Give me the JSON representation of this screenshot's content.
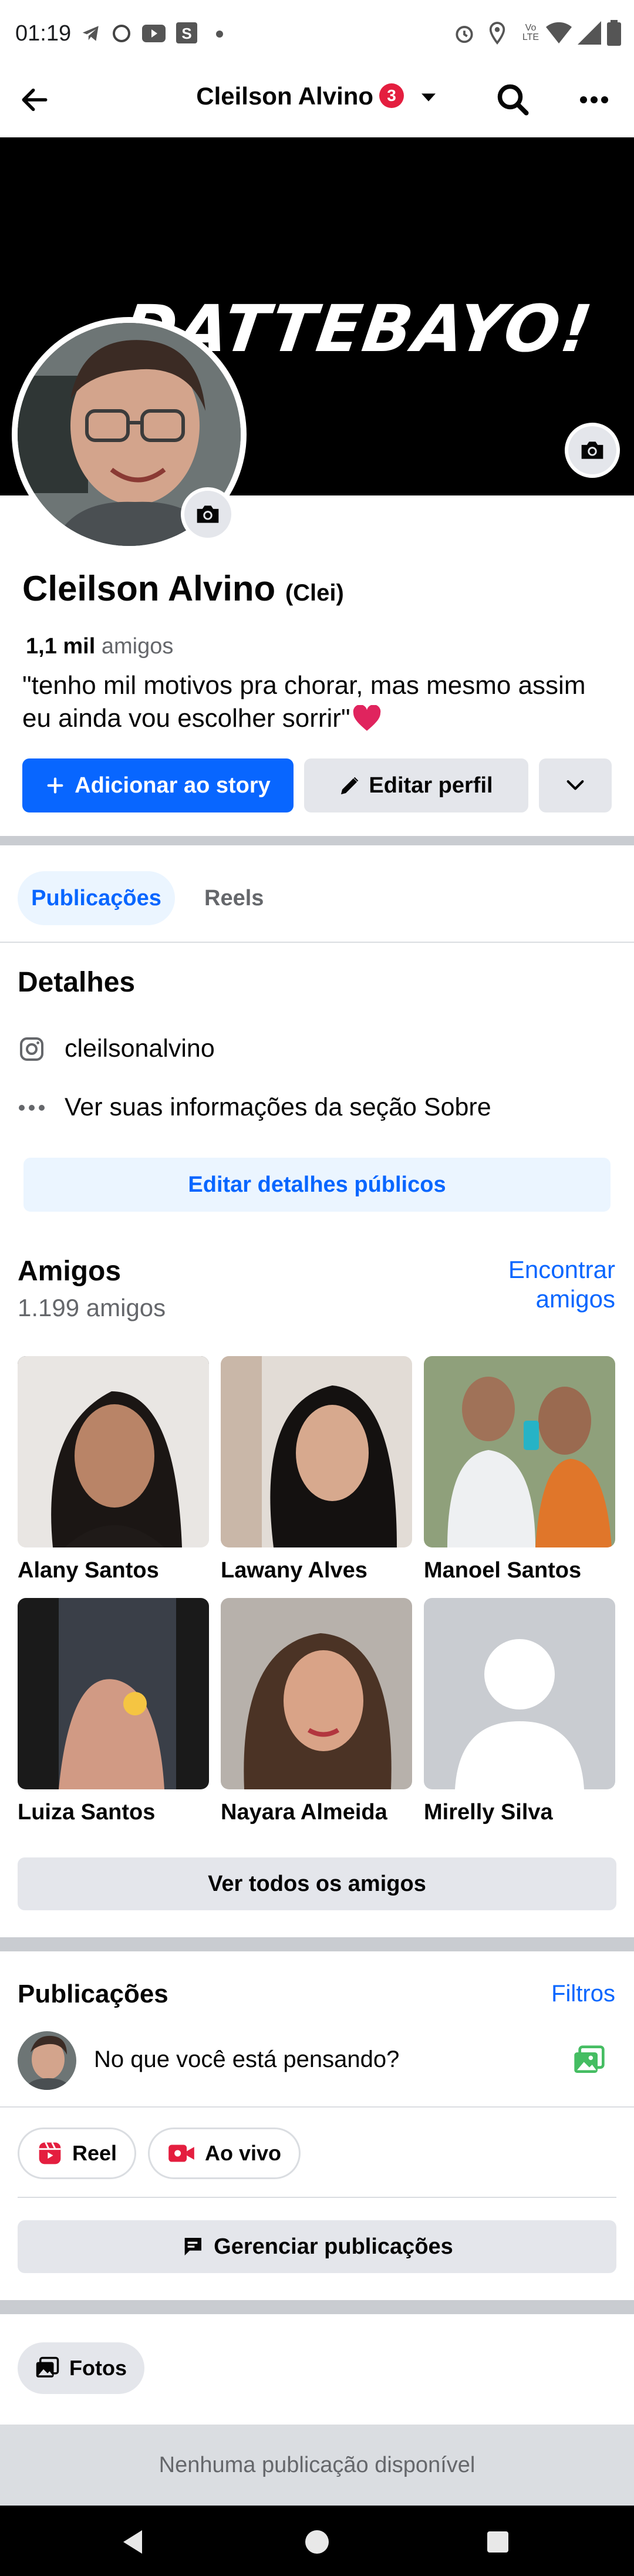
{
  "status_bar": {
    "time": "01:19",
    "network_label": "Vo LTE"
  },
  "header": {
    "title": "Cleilson Alvino",
    "badge": "3"
  },
  "cover": {
    "text": "DATTEBAYO!"
  },
  "profile": {
    "name": "Cleilson Alvino",
    "nickname": "(Clei)",
    "friends_count_bold": "1,1 mil",
    "friends_count_label": "amigos",
    "bio_line1": "\"tenho mil motivos pra chorar, mas mesmo assim",
    "bio_line2": "eu ainda vou escolher sorrir\""
  },
  "actions": {
    "add_story": "Adicionar ao story",
    "edit_profile": "Editar perfil"
  },
  "tabs": [
    {
      "label": "Publicações"
    },
    {
      "label": "Reels"
    }
  ],
  "details": {
    "title": "Detalhes",
    "instagram": "cleilsonalvino",
    "about": "Ver suas informações da seção Sobre",
    "edit_button": "Editar detalhes públicos"
  },
  "friends": {
    "title": "Amigos",
    "count": "1.199 amigos",
    "find_line1": "Encontrar",
    "find_line2": "amigos",
    "list": [
      {
        "name": "Alany Santos"
      },
      {
        "name": "Lawany Alves"
      },
      {
        "name": "Manoel Santos"
      },
      {
        "name": "Luiza Santos"
      },
      {
        "name": "Nayara Almeida"
      },
      {
        "name": "Mirelly Silva"
      }
    ],
    "see_all": "Ver todos os amigos"
  },
  "posts": {
    "title": "Publicações",
    "filters": "Filtros",
    "composer_placeholder": "No que você está pensando?",
    "reel": "Reel",
    "live": "Ao vivo",
    "manage": "Gerenciar publicações",
    "photos": "Fotos",
    "empty": "Nenhuma publicação disponível"
  },
  "colors": {
    "accent": "#0866ff",
    "badge": "#e41e3f",
    "heart": "#e0245e",
    "photo_green": "#45bd62"
  }
}
